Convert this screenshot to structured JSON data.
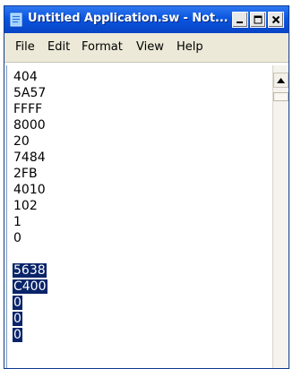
{
  "window": {
    "title": "Untitled Application.sw - Not...",
    "buttons": {
      "minimize": "minimize",
      "maximize": "maximize",
      "close": "close"
    }
  },
  "menu": [
    "File",
    "Edit",
    "Format",
    "View",
    "Help"
  ],
  "editor": {
    "lines": [
      {
        "text": "404",
        "selected": false
      },
      {
        "text": "5A57",
        "selected": false
      },
      {
        "text": "FFFF",
        "selected": false
      },
      {
        "text": "8000",
        "selected": false
      },
      {
        "text": "20",
        "selected": false
      },
      {
        "text": "7484",
        "selected": false
      },
      {
        "text": "2FB",
        "selected": false
      },
      {
        "text": "4010",
        "selected": false
      },
      {
        "text": "102",
        "selected": false
      },
      {
        "text": "1",
        "selected": false
      },
      {
        "text": "0",
        "selected": false
      },
      {
        "text": "",
        "selected": false
      },
      {
        "text": "5638",
        "selected": true
      },
      {
        "text": "C400",
        "selected": true
      },
      {
        "text": "0",
        "selected": true
      },
      {
        "text": "0",
        "selected": true
      },
      {
        "text": "0",
        "selected": true
      }
    ],
    "selection_color": "#0a246a"
  },
  "icons": {
    "app": "notepad-icon",
    "minimize": "minimize-icon",
    "maximize": "maximize-icon",
    "close": "close-icon",
    "scroll_up": "scroll-up-arrow-icon"
  }
}
